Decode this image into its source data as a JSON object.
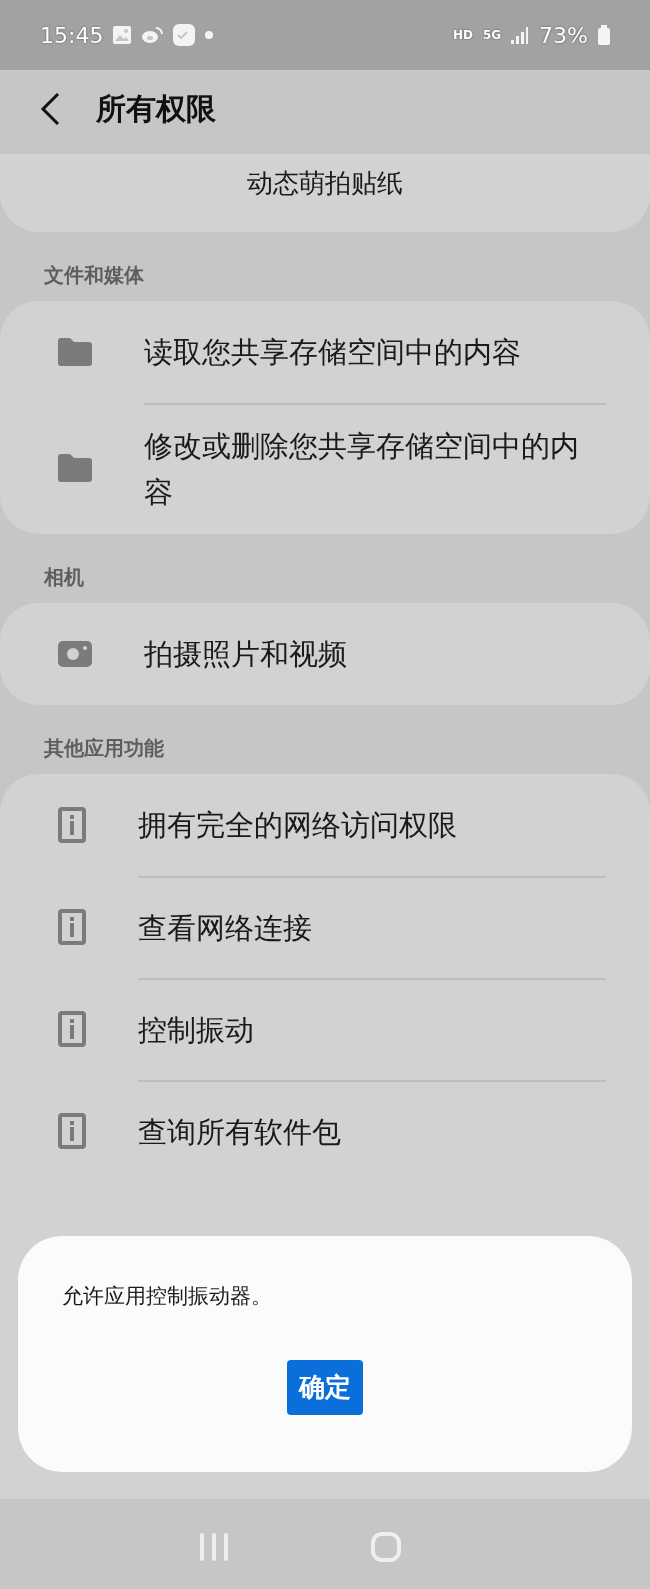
{
  "status_bar": {
    "time": "15:45",
    "network_badges": [
      "HD",
      "5G"
    ],
    "battery_text": "73%"
  },
  "header": {
    "title": "所有权限"
  },
  "top_item": {
    "label": "动态萌拍贴纸"
  },
  "sections": [
    {
      "title": "文件和媒体",
      "items": [
        {
          "kind": "folder",
          "label": "读取您共享存储空间中的内容"
        },
        {
          "kind": "folder",
          "label": "修改或删除您共享存储空间中的内容"
        }
      ]
    },
    {
      "title": "相机",
      "items": [
        {
          "kind": "camera",
          "label": "拍摄照片和视频"
        }
      ]
    },
    {
      "title": "其他应用功能",
      "items": [
        {
          "kind": "info",
          "label": "拥有完全的网络访问权限"
        },
        {
          "kind": "info",
          "label": "查看网络连接"
        },
        {
          "kind": "info",
          "label": "控制振动"
        },
        {
          "kind": "info",
          "label": "查询所有软件包"
        }
      ]
    }
  ],
  "dialog": {
    "message": "允许应用控制振动器。",
    "button": "确定"
  }
}
